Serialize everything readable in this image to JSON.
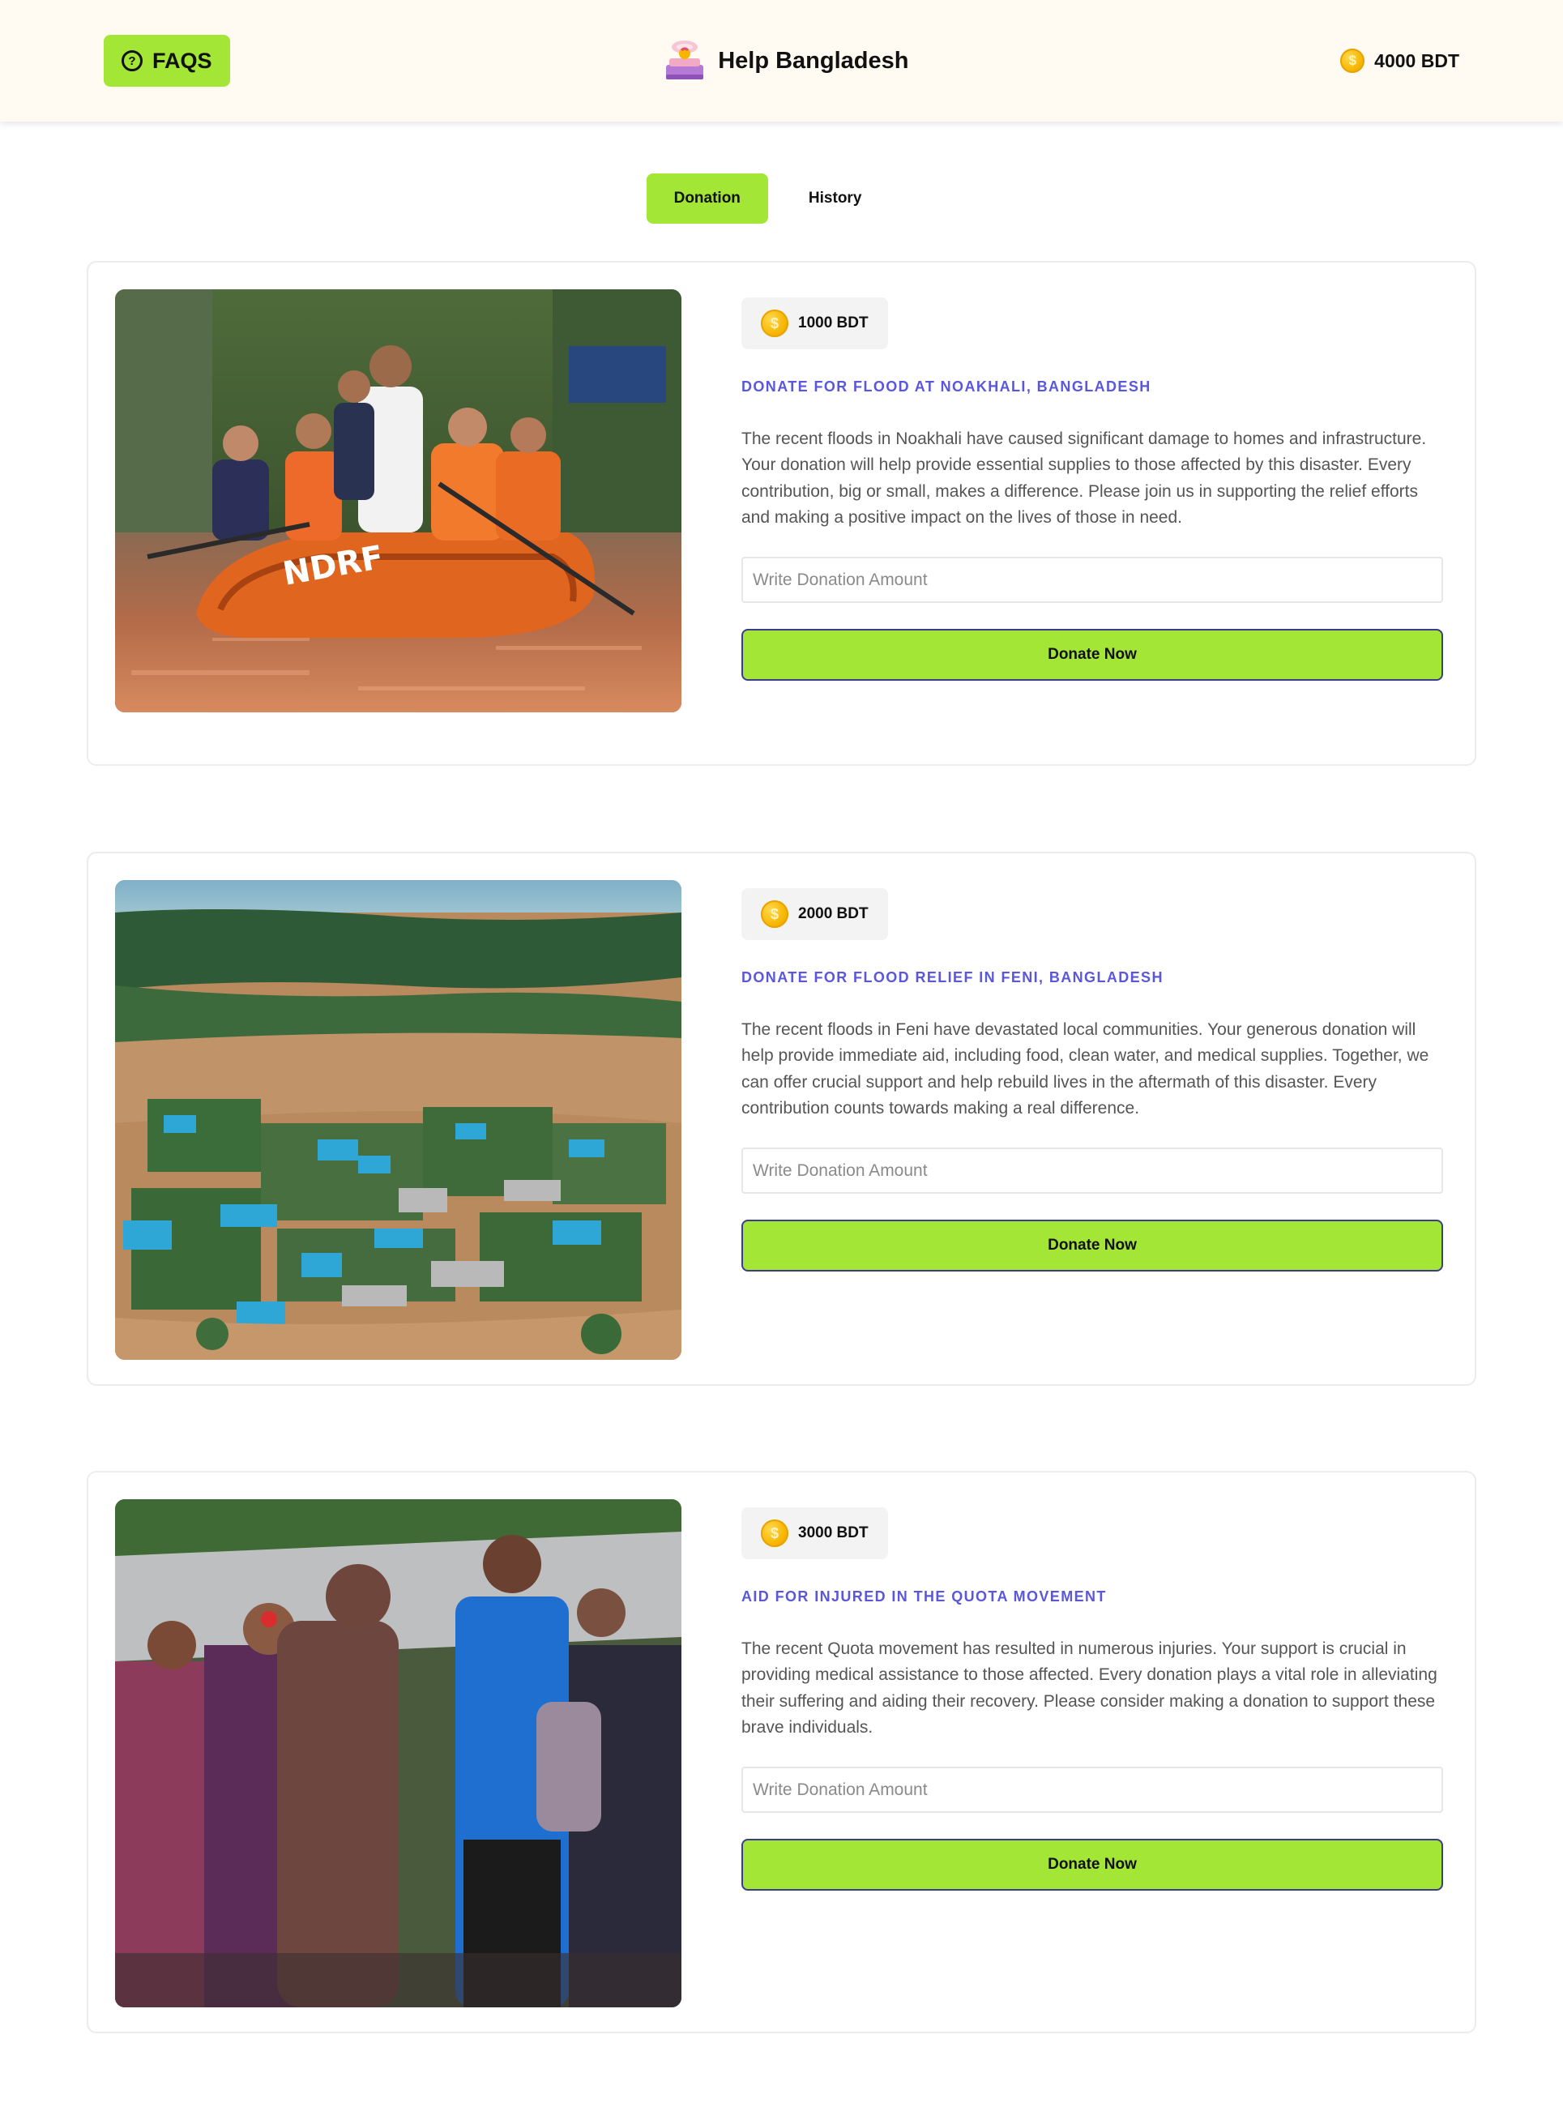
{
  "header": {
    "faq_label": "FAQS",
    "brand_title": "Help Bangladesh",
    "balance": "4000 BDT"
  },
  "tabs": [
    {
      "label": "Donation",
      "active": true
    },
    {
      "label": "History",
      "active": false
    }
  ],
  "cards": [
    {
      "amount": "1000 BDT",
      "title": "DONATE FOR FLOOD AT NOAKHALI, BANGLADESH",
      "description": "The recent floods in Noakhali have caused significant damage to homes and infrastructure. Your donation will help provide essential supplies to those affected by this disaster. Every contribution, big or small, makes a difference. Please join us in supporting the relief efforts and making a positive impact on the lives of those in need.",
      "input_placeholder": "Write Donation Amount",
      "button_label": "Donate Now"
    },
    {
      "amount": "2000 BDT",
      "title": "DONATE FOR FLOOD RELIEF IN FENI, BANGLADESH",
      "description": "The recent floods in Feni have devastated local communities. Your generous donation will help provide immediate aid, including food, clean water, and medical supplies. Together, we can offer crucial support and help rebuild lives in the aftermath of this disaster. Every contribution counts towards making a real difference.",
      "input_placeholder": "Write Donation Amount",
      "button_label": "Donate Now"
    },
    {
      "amount": "3000 BDT",
      "title": "AID FOR INJURED IN THE QUOTA MOVEMENT",
      "description": "The recent Quota movement has resulted in numerous injuries. Your support is crucial in providing medical assistance to those affected. Every donation plays a vital role in alleviating their suffering and aiding their recovery. Please consider making a donation to support these brave individuals.",
      "input_placeholder": "Write Donation Amount",
      "button_label": "Donate Now"
    }
  ],
  "colors": {
    "accent": "#a3e635",
    "title": "#5b57dd",
    "header_bg": "#fffaf2",
    "coin": "#f7b500"
  },
  "icons": {
    "faq": "question-circle-icon",
    "brand": "donation-box-icon",
    "coin": "dollar-coin-icon"
  }
}
